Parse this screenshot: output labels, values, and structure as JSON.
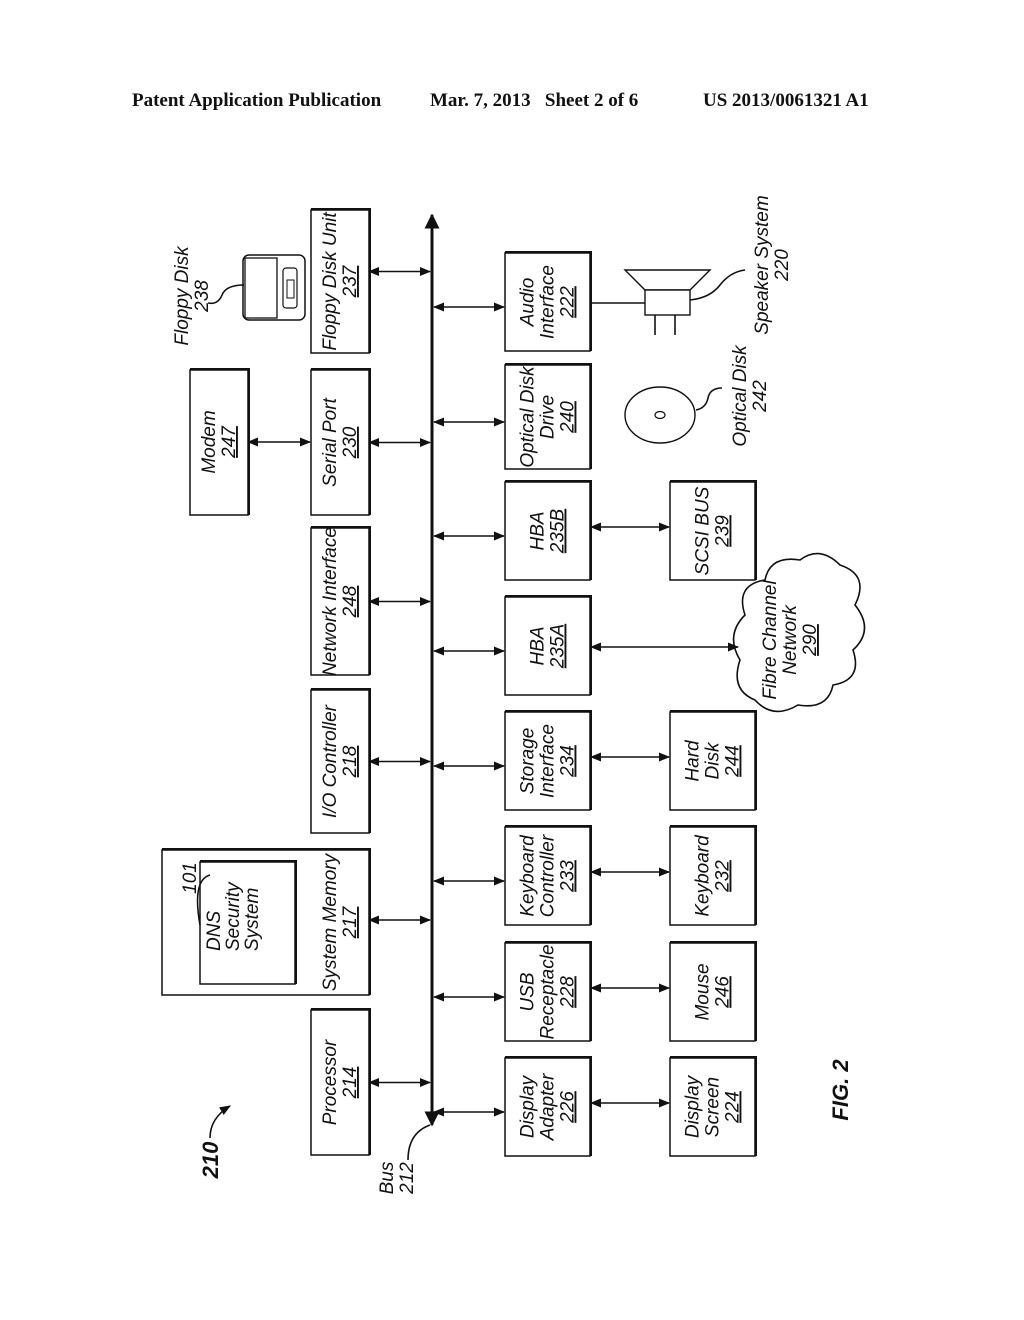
{
  "header": {
    "publication": "Patent Application Publication",
    "date_sheet": "Mar. 7, 2013   Sheet 2 of 6",
    "number": "US 2013/0061321 A1"
  },
  "figure": {
    "label": "FIG. 2",
    "system_ref": "210",
    "bus": {
      "name": "Bus",
      "ref": "212"
    }
  },
  "top_row": [
    {
      "id": "processor",
      "lines": [
        "Processor"
      ],
      "ref": "214"
    },
    {
      "id": "system-memory",
      "lines": [
        "System Memory"
      ],
      "ref": "217",
      "inner": {
        "lines": [
          "DNS",
          "Security",
          "System"
        ],
        "ref": "101"
      }
    },
    {
      "id": "io-controller",
      "lines": [
        "I/O Controller"
      ],
      "ref": "218"
    },
    {
      "id": "network-interface",
      "lines": [
        "Network Interface"
      ],
      "ref": "248"
    },
    {
      "id": "serial-port",
      "lines": [
        "Serial Port"
      ],
      "ref": "230"
    },
    {
      "id": "floppy-disk-unit",
      "lines": [
        "Floppy Disk Unit"
      ],
      "ref": "237"
    }
  ],
  "modem": {
    "lines": [
      "Modem"
    ],
    "ref": "247"
  },
  "floppy_disk": {
    "name": "Floppy Disk",
    "ref": "238"
  },
  "bottom_row": [
    {
      "id": "display-adapter",
      "lines": [
        "Display",
        "Adapter"
      ],
      "ref": "226"
    },
    {
      "id": "usb-receptacle",
      "lines": [
        "USB",
        "Receptacle"
      ],
      "ref": "228"
    },
    {
      "id": "keyboard-controller",
      "lines": [
        "Keyboard",
        "Controller"
      ],
      "ref": "233"
    },
    {
      "id": "storage-interface",
      "lines": [
        "Storage",
        "Interface"
      ],
      "ref": "234"
    },
    {
      "id": "hba-a",
      "lines": [
        "HBA"
      ],
      "ref": "235A"
    },
    {
      "id": "hba-b",
      "lines": [
        "HBA"
      ],
      "ref": "235B"
    },
    {
      "id": "optical-disk-drive",
      "lines": [
        "Optical Disk",
        "Drive"
      ],
      "ref": "240"
    },
    {
      "id": "audio-interface",
      "lines": [
        "Audio",
        "Interface"
      ],
      "ref": "222"
    }
  ],
  "peripherals": [
    {
      "id": "display-screen",
      "lines": [
        "Display",
        "Screen"
      ],
      "ref": "224"
    },
    {
      "id": "mouse",
      "lines": [
        "Mouse"
      ],
      "ref": "246"
    },
    {
      "id": "keyboard",
      "lines": [
        "Keyboard"
      ],
      "ref": "232"
    },
    {
      "id": "hard-disk",
      "lines": [
        "Hard",
        "Disk"
      ],
      "ref": "244"
    },
    {
      "id": "scsi-bus",
      "lines": [
        "SCSI BUS"
      ],
      "ref": "239"
    }
  ],
  "fibre_channel": {
    "lines": [
      "Fibre Channel",
      "Network"
    ],
    "ref": "290"
  },
  "optical_disk": {
    "name": "Optical Disk",
    "ref": "242"
  },
  "speaker": {
    "name": "Speaker System",
    "ref": "220"
  }
}
